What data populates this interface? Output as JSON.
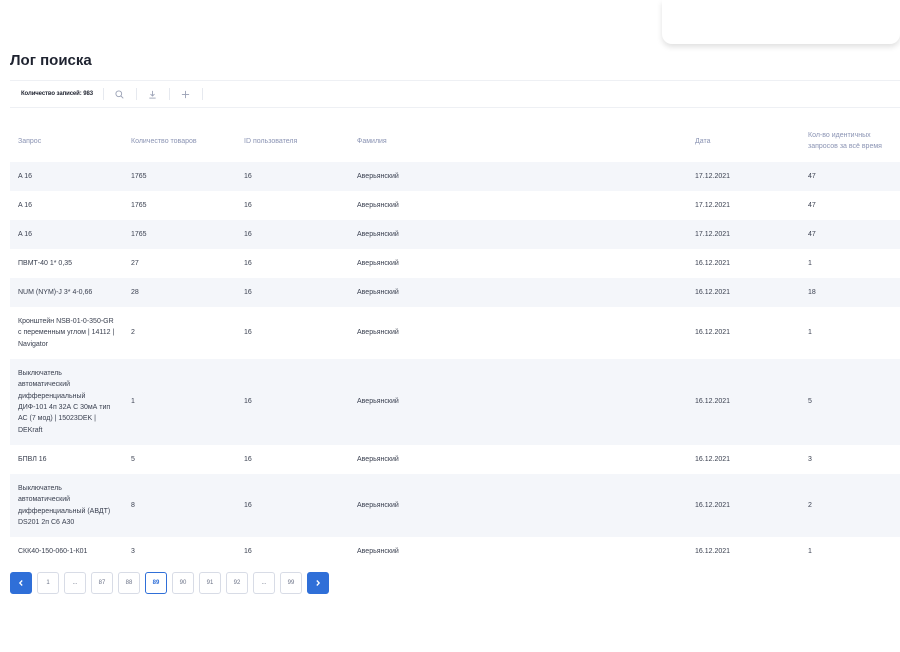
{
  "page": {
    "title": "Лог поиска"
  },
  "toolbar": {
    "records_label": "Количество записей: 983",
    "search_icon": "search-icon",
    "download_icon": "download-icon",
    "add_icon": "plus-icon"
  },
  "table": {
    "columns": {
      "query": "Запрос",
      "product_count": "Количество товаров",
      "user_id": "ID пользователя",
      "surname": "Фамилия",
      "date": "Дата",
      "identical": "Кол-во идентичных запросов за всё время"
    },
    "rows": [
      {
        "query": "A 16",
        "product_count": "1765",
        "user_id": "16",
        "surname": "Аверьянский",
        "date": "17.12.2021",
        "identical": "47"
      },
      {
        "query": "A 16",
        "product_count": "1765",
        "user_id": "16",
        "surname": "Аверьянский",
        "date": "17.12.2021",
        "identical": "47"
      },
      {
        "query": "A 16",
        "product_count": "1765",
        "user_id": "16",
        "surname": "Аверьянский",
        "date": "17.12.2021",
        "identical": "47"
      },
      {
        "query": "ПВМТ-40 1* 0,35",
        "product_count": "27",
        "user_id": "16",
        "surname": "Аверьянский",
        "date": "16.12.2021",
        "identical": "1"
      },
      {
        "query": "NUM (NYM)-J 3* 4-0,66",
        "product_count": "28",
        "user_id": "16",
        "surname": "Аверьянский",
        "date": "16.12.2021",
        "identical": "18"
      },
      {
        "query": "Кронштейн NSB-01-0-350-GR с переменным углом | 14112 | Navigator",
        "product_count": "2",
        "user_id": "16",
        "surname": "Аверьянский",
        "date": "16.12.2021",
        "identical": "1"
      },
      {
        "query": "Выключатель автоматический дифференциальный ДИФ-101 4п 32А С 30мА тип АС (7 мод) | 15023DEK | DEKraft",
        "product_count": "1",
        "user_id": "16",
        "surname": "Аверьянский",
        "date": "16.12.2021",
        "identical": "5"
      },
      {
        "query": "БПВЛ 16",
        "product_count": "5",
        "user_id": "16",
        "surname": "Аверьянский",
        "date": "16.12.2021",
        "identical": "3"
      },
      {
        "query": "Выключатель автоматический дифференциальный (АВДТ) DS201 2п С6 А30",
        "product_count": "8",
        "user_id": "16",
        "surname": "Аверьянский",
        "date": "16.12.2021",
        "identical": "2"
      },
      {
        "query": "СКК40-150-060-1-К01",
        "product_count": "3",
        "user_id": "16",
        "surname": "Аверьянский",
        "date": "16.12.2021",
        "identical": "1"
      }
    ]
  },
  "pagination": {
    "prev_icon": "chevron-left-icon",
    "next_icon": "chevron-right-icon",
    "pages": [
      "1",
      "...",
      "87",
      "88",
      "89",
      "90",
      "91",
      "92",
      "...",
      "99"
    ],
    "active": "89"
  },
  "colors": {
    "accent": "#2f6fd8",
    "header_text": "#8a93b3",
    "row_stripe": "#f4f6fa"
  }
}
